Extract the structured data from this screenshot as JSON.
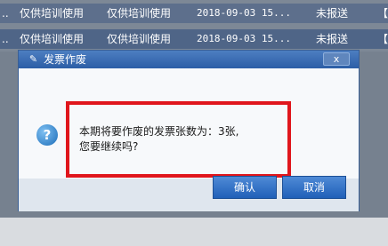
{
  "table": {
    "rows": [
      {
        "c0": "..",
        "c1": "仅供培训使用",
        "c2": "仅供培训使用",
        "c3": "2018-09-03 15...",
        "c4": "未报送",
        "c5": "【"
      },
      {
        "c0": "..",
        "c1": "仅供培训使用",
        "c2": "仅供培训使用",
        "c3": "2018-09-03 15...",
        "c4": "未报送",
        "c5": "【"
      }
    ]
  },
  "dialog": {
    "title": "发票作废",
    "title_icon": "invoice-void-icon",
    "close_label": "x",
    "message_line1": "本期将要作废的发票张数为：3张,",
    "message_line2": "您要继续吗?",
    "question_icon": "question-icon",
    "ok_label": "确认",
    "cancel_label": "取消"
  },
  "colors": {
    "title_bar": "#2c5ea6",
    "button": "#2060b8",
    "highlight": "#e0161c"
  }
}
